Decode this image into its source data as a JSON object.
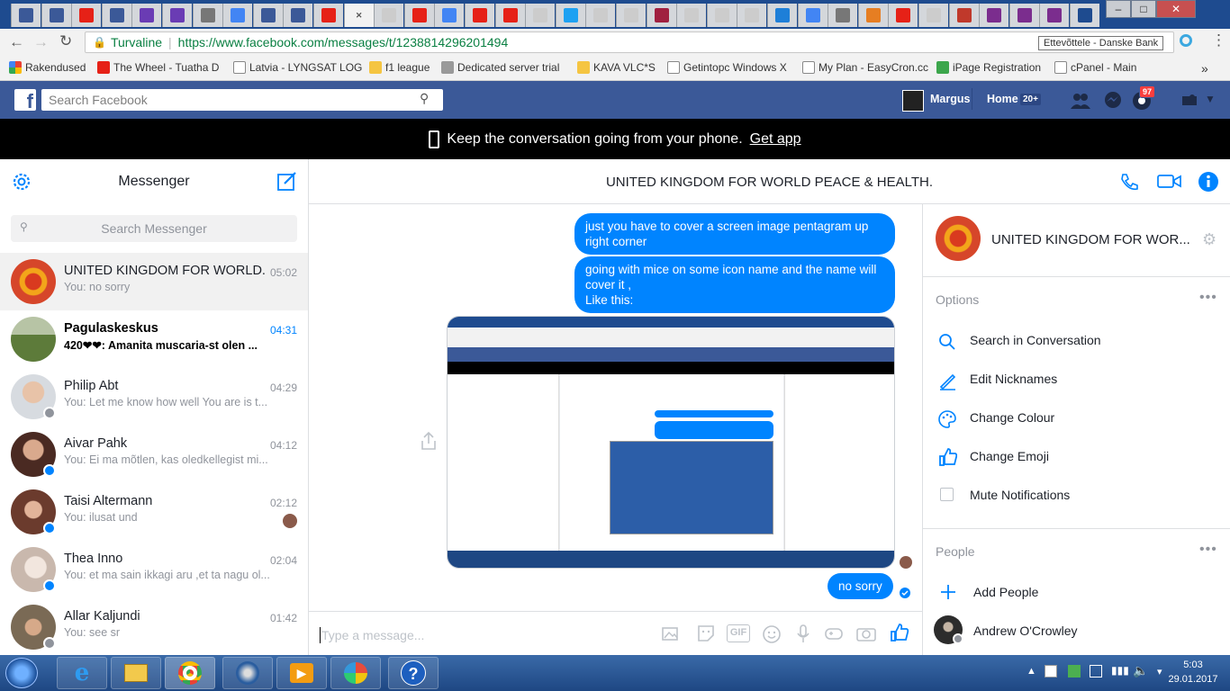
{
  "browser": {
    "secure_label": "Turvaline",
    "url": "https://www.facebook.com/messages/t/1238814296201494",
    "tooltip": "Ettevõttele - Danske Bank",
    "bookmarks": [
      "Rakendused",
      "The Wheel - Tuatha D",
      "Latvia - LYNGSAT LOG",
      "f1 league",
      "Dedicated server trial",
      "KAVA VLC*S",
      "Getintopc Windows X",
      "My Plan - EasyCron.cc",
      "iPage Registration",
      "cPanel - Main"
    ],
    "more_bookmarks": "»"
  },
  "fb": {
    "search_placeholder": "Search Facebook",
    "user_name": "Margus",
    "home_label": "Home",
    "home_count": "20+",
    "notif_count": "97"
  },
  "banner": {
    "text": "Keep the conversation going from your phone.",
    "link": "Get app"
  },
  "messenger": {
    "title": "Messenger",
    "search_placeholder": "Search Messenger",
    "conversations": [
      {
        "name": "UNITED KINGDOM FOR WORLD...",
        "time": "05:02",
        "preview": "You: no sorry"
      },
      {
        "name": "Pagulaskeskus",
        "time": "04:31",
        "preview": "420❤❤: Amanita muscaria-st olen ..."
      },
      {
        "name": "Philip Abt",
        "time": "04:29",
        "preview": "You: Let me know how well You are is t..."
      },
      {
        "name": "Aivar Pahk",
        "time": "04:12",
        "preview": "You: Ei ma mõtlen, kas oledkellegist mi..."
      },
      {
        "name": "Taisi Altermann",
        "time": "02:12",
        "preview": "You: ilusat und"
      },
      {
        "name": "Thea Inno",
        "time": "02:04",
        "preview": "You: et ma sain ikkagi aru ,et ta nagu ol..."
      },
      {
        "name": "Allar Kaljundi",
        "time": "01:42",
        "preview": "You: see sr"
      }
    ]
  },
  "chat": {
    "title": "UNITED KINGDOM FOR WORLD PEACE & HEALTH.",
    "messages": [
      "just you have to cover a screen image pentagram  up right corner",
      "going with mice on some icon name and the name will cover it ,\nLike this:",
      "no sorry"
    ],
    "input_placeholder": "Type a message...",
    "gif_label": "GIF"
  },
  "info": {
    "name": "UNITED KINGDOM FOR WOR...",
    "options_header": "Options",
    "options": [
      "Search in Conversation",
      "Edit Nicknames",
      "Change Colour",
      "Change Emoji",
      "Mute Notifications"
    ],
    "people_header": "People",
    "add_people": "Add People",
    "person": "Andrew O'Crowley"
  },
  "taskbar": {
    "time": "5:03",
    "date": "29.01.2017"
  },
  "colors": {
    "fb_blue": "#3b5998",
    "messenger_blue": "#0084ff"
  }
}
